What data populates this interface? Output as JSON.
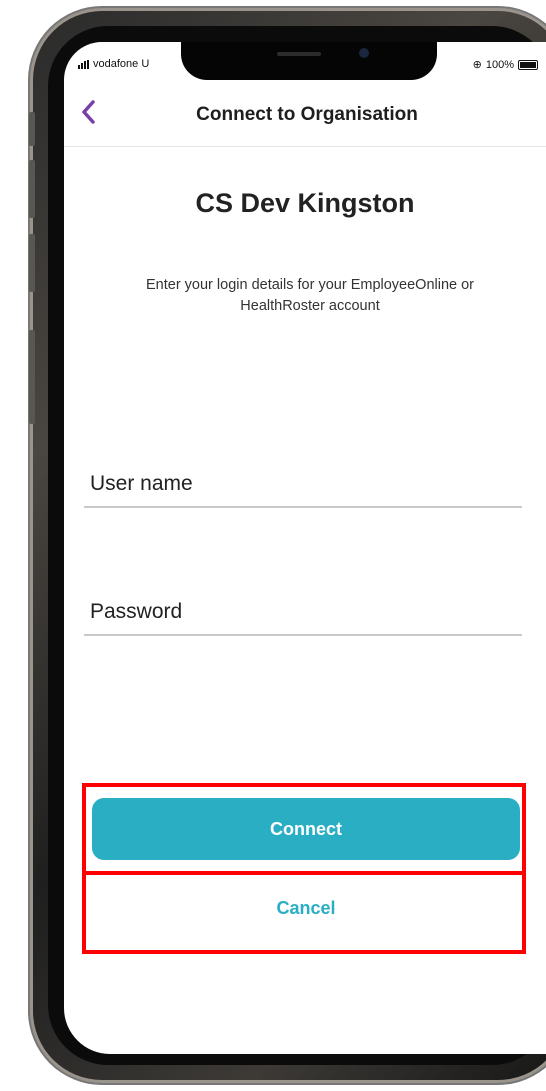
{
  "status_bar": {
    "carrier": "vodafone U",
    "battery": "100%"
  },
  "nav": {
    "title": "Connect to Organisation",
    "back_icon": "chevron-left-icon"
  },
  "organisation": {
    "name": "CS Dev Kingston"
  },
  "instructions": {
    "text": "Enter your login details for your EmployeeOnline or HealthRoster account"
  },
  "form": {
    "username_placeholder": "User name",
    "username_value": "",
    "password_placeholder": "Password",
    "password_value": ""
  },
  "actions": {
    "connect_label": "Connect",
    "cancel_label": "Cancel"
  },
  "colors": {
    "accent": "#2aaec4",
    "back_arrow": "#7b3fa8",
    "highlight": "#ff0000"
  }
}
